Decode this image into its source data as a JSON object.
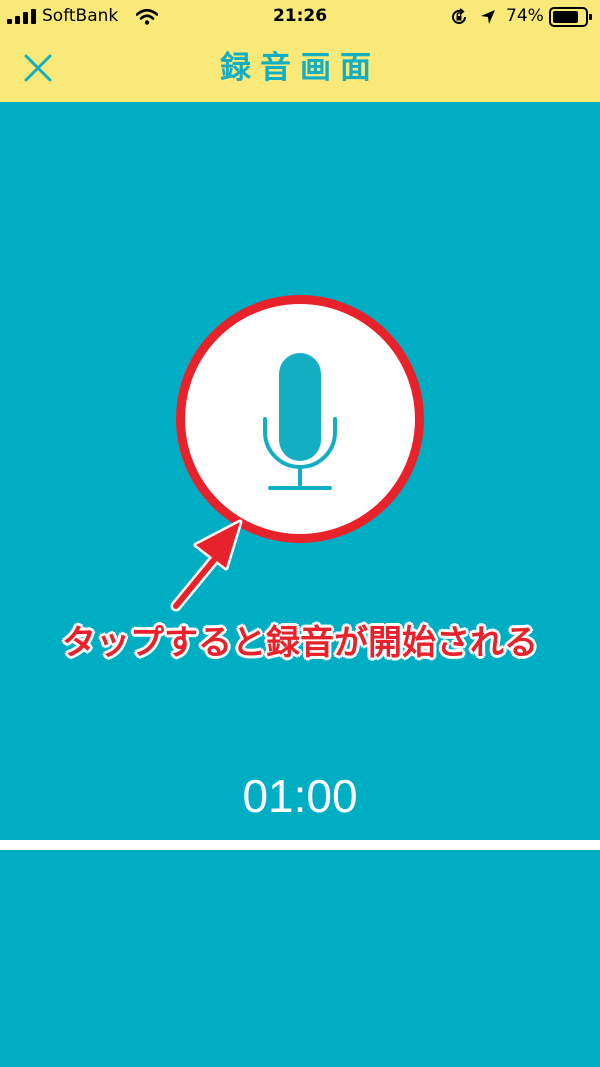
{
  "status_bar": {
    "carrier": "SoftBank",
    "time": "21:26",
    "battery_percent": "74%"
  },
  "header": {
    "title": "録音画面",
    "close_icon": "close-icon"
  },
  "recorder": {
    "mic_icon": "microphone-icon",
    "timer": "01:00"
  },
  "annotation": {
    "text": "タップすると録音が開始される",
    "color": "#e8222b"
  },
  "colors": {
    "header_bg": "#f8e978",
    "accent": "#14aec3",
    "background": "#00aec4"
  }
}
